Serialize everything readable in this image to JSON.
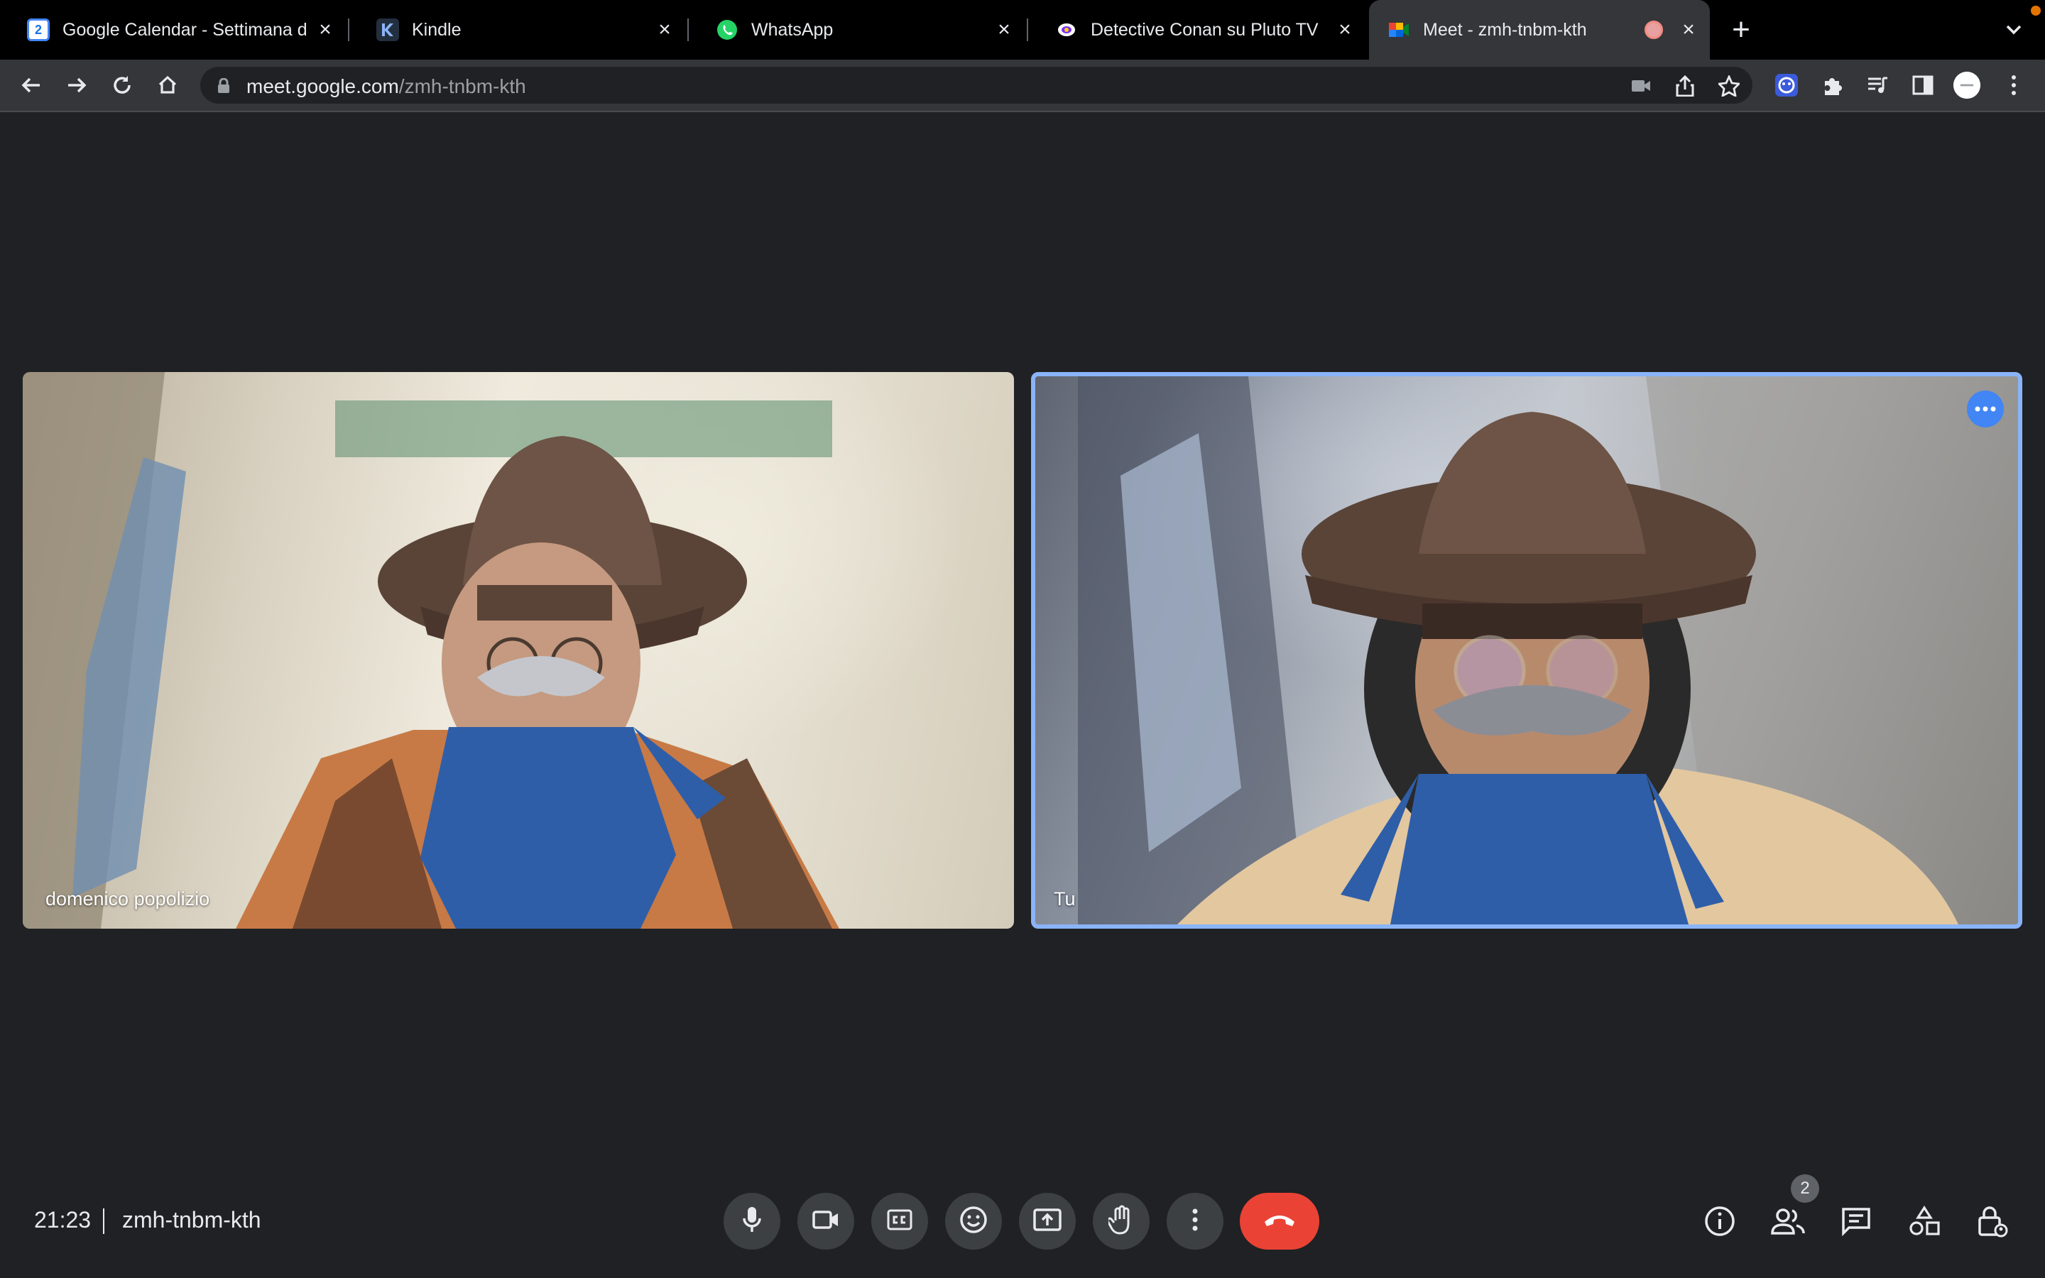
{
  "browser": {
    "tabs": [
      {
        "title": "Google Calendar - Settimana d",
        "favicon": "google-calendar-icon",
        "favicon_text": "2"
      },
      {
        "title": "Kindle",
        "favicon": "kindle-icon"
      },
      {
        "title": "WhatsApp",
        "favicon": "whatsapp-icon"
      },
      {
        "title": "Detective Conan su Pluto TV",
        "favicon": "pluto-tv-icon"
      },
      {
        "title": "Meet - zmh-tnbm-kth",
        "favicon": "google-meet-icon",
        "active": true,
        "recording": true
      }
    ],
    "new_tab_label": "+",
    "url_host": "meet.google.com",
    "url_path": "/zmh-tnbm-kth"
  },
  "participants": [
    {
      "name": "domenico popolizio"
    },
    {
      "name": "Tu",
      "is_self": true
    }
  ],
  "bottom_bar": {
    "time": "21:23",
    "meeting_code": "zmh-tnbm-kth",
    "people_count": "2",
    "controls": [
      "microphone-icon",
      "camera-icon",
      "captions-icon",
      "emoji-icon",
      "present-icon",
      "raise-hand-icon",
      "more-options-icon",
      "hang-up-icon"
    ],
    "right_controls": [
      "meeting-info-icon",
      "people-icon",
      "chat-icon",
      "activities-icon",
      "host-controls-icon"
    ]
  },
  "colors": {
    "background": "#202124",
    "hangup": "#ea4335",
    "active_speaker_border": "#8ab4f8",
    "tile_menu": "#4285f4"
  }
}
